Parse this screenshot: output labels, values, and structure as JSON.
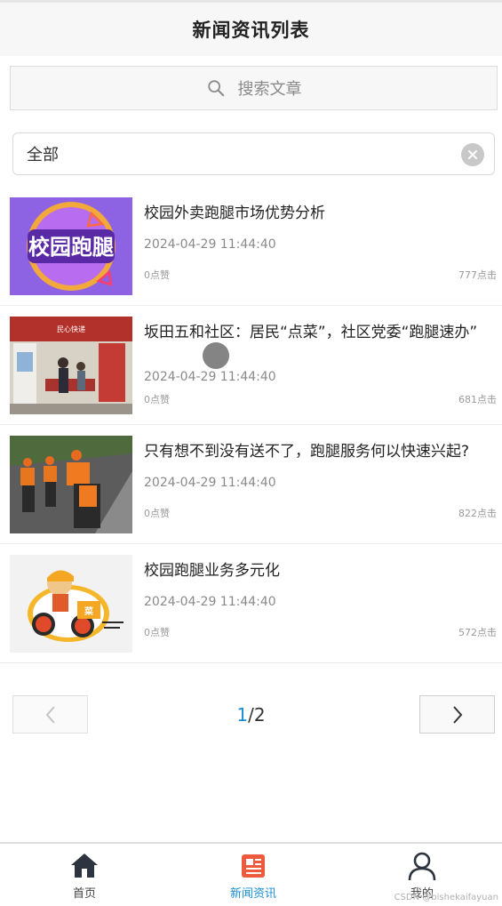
{
  "header": {
    "title": "新闻资讯列表"
  },
  "search": {
    "placeholder": "搜索文章",
    "icon": "search-icon"
  },
  "filter": {
    "value": "全部",
    "clear_icon": "clear-circle-icon"
  },
  "articles": [
    {
      "title": "校园外卖跑腿市场优势分析",
      "date": "2024-04-29 11:44:40",
      "likes": "0点赞",
      "clicks": "777点击",
      "image_text": "校园跑腿"
    },
    {
      "title": "坂田五和社区：居民“点菜”，社区党委“跑腿速办”",
      "date": "2024-04-29 11:44:40",
      "likes": "0点赞",
      "clicks": "681点击",
      "image_text": "民心快递"
    },
    {
      "title": "只有想不到没有送不了，跑腿服务何以快速兴起?",
      "date": "2024-04-29 11:44:40",
      "likes": "0点赞",
      "clicks": "822点击"
    },
    {
      "title": "校园跑腿业务多元化",
      "date": "2024-04-29 11:44:40",
      "likes": "0点赞",
      "clicks": "572点击",
      "image_text": "菜"
    }
  ],
  "pager": {
    "current": "1",
    "sep_total": "/2"
  },
  "tabbar": {
    "items": [
      {
        "label": "首页",
        "icon": "home-icon"
      },
      {
        "label": "新闻资讯",
        "icon": "news-icon"
      },
      {
        "label": "我的",
        "icon": "user-icon"
      }
    ]
  },
  "watermark": "CSDN @bishekaifayuan",
  "colors": {
    "accent": "#1a8fd6",
    "news_icon": "#ef5a3c",
    "header_bg": "#f7f7f7"
  }
}
